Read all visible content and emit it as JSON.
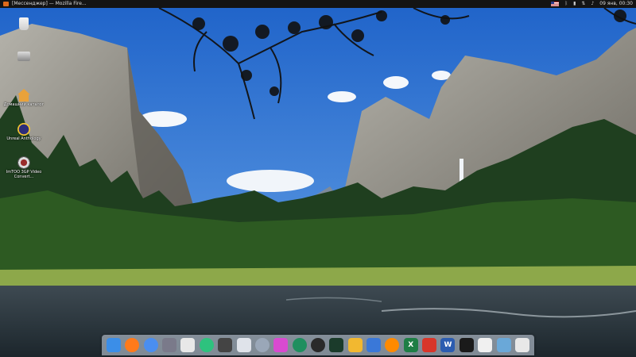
{
  "topbar": {
    "window_title": "[Мессенджер] — Mozilla Fire...",
    "clock": "09 янв, 00:30"
  },
  "desktop_icons": [
    {
      "name": "trash",
      "label": ""
    },
    {
      "name": "drive",
      "label": ""
    },
    {
      "name": "home",
      "label": "Домашний каталог"
    },
    {
      "name": "unreal-anthology",
      "label": "Unreal Anthology"
    },
    {
      "name": "video-converter",
      "label": "ImTOO 3GP Video Convert..."
    }
  ],
  "dock": {
    "items": [
      {
        "name": "finder",
        "label": "",
        "color": "#3b8ee8"
      },
      {
        "name": "firefox",
        "label": "",
        "color": "#ff7a1a"
      },
      {
        "name": "chromium",
        "label": "",
        "color": "#4a8ef0"
      },
      {
        "name": "cleaner",
        "label": "",
        "color": "#7a7a8a"
      },
      {
        "name": "camera",
        "label": "",
        "color": "#e8e8e8"
      },
      {
        "name": "app-store",
        "label": "",
        "color": "#2ec27e"
      },
      {
        "name": "hdd",
        "label": "",
        "color": "#444444"
      },
      {
        "name": "folder",
        "label": "",
        "color": "#dfe3ea"
      },
      {
        "name": "butterfly",
        "label": "",
        "color": "#9aa7b8"
      },
      {
        "name": "media-player",
        "label": "",
        "color": "#d94ad0"
      },
      {
        "name": "time-machine",
        "label": "",
        "color": "#1f8f5f"
      },
      {
        "name": "terminal-round",
        "label": "",
        "color": "#2a2a2a"
      },
      {
        "name": "monitor",
        "label": "",
        "color": "#1b3b2b"
      },
      {
        "name": "notes",
        "label": "",
        "color": "#f2b830"
      },
      {
        "name": "settings",
        "label": "",
        "color": "#3a78d8"
      },
      {
        "name": "vlc",
        "label": "",
        "color": "#ff8a00"
      },
      {
        "name": "excel",
        "label": "X",
        "color": "#1e7e45"
      },
      {
        "name": "wps-pdf",
        "label": "",
        "color": "#d8362a"
      },
      {
        "name": "word",
        "label": "W",
        "color": "#2b5cb0"
      },
      {
        "name": "console",
        "label": "",
        "color": "#1a1a1a"
      },
      {
        "name": "document",
        "label": "",
        "color": "#f0f0f0"
      },
      {
        "name": "image-viewer",
        "label": "",
        "color": "#6aa8d8"
      },
      {
        "name": "trash",
        "label": "",
        "color": "#e8e8e8"
      }
    ]
  }
}
